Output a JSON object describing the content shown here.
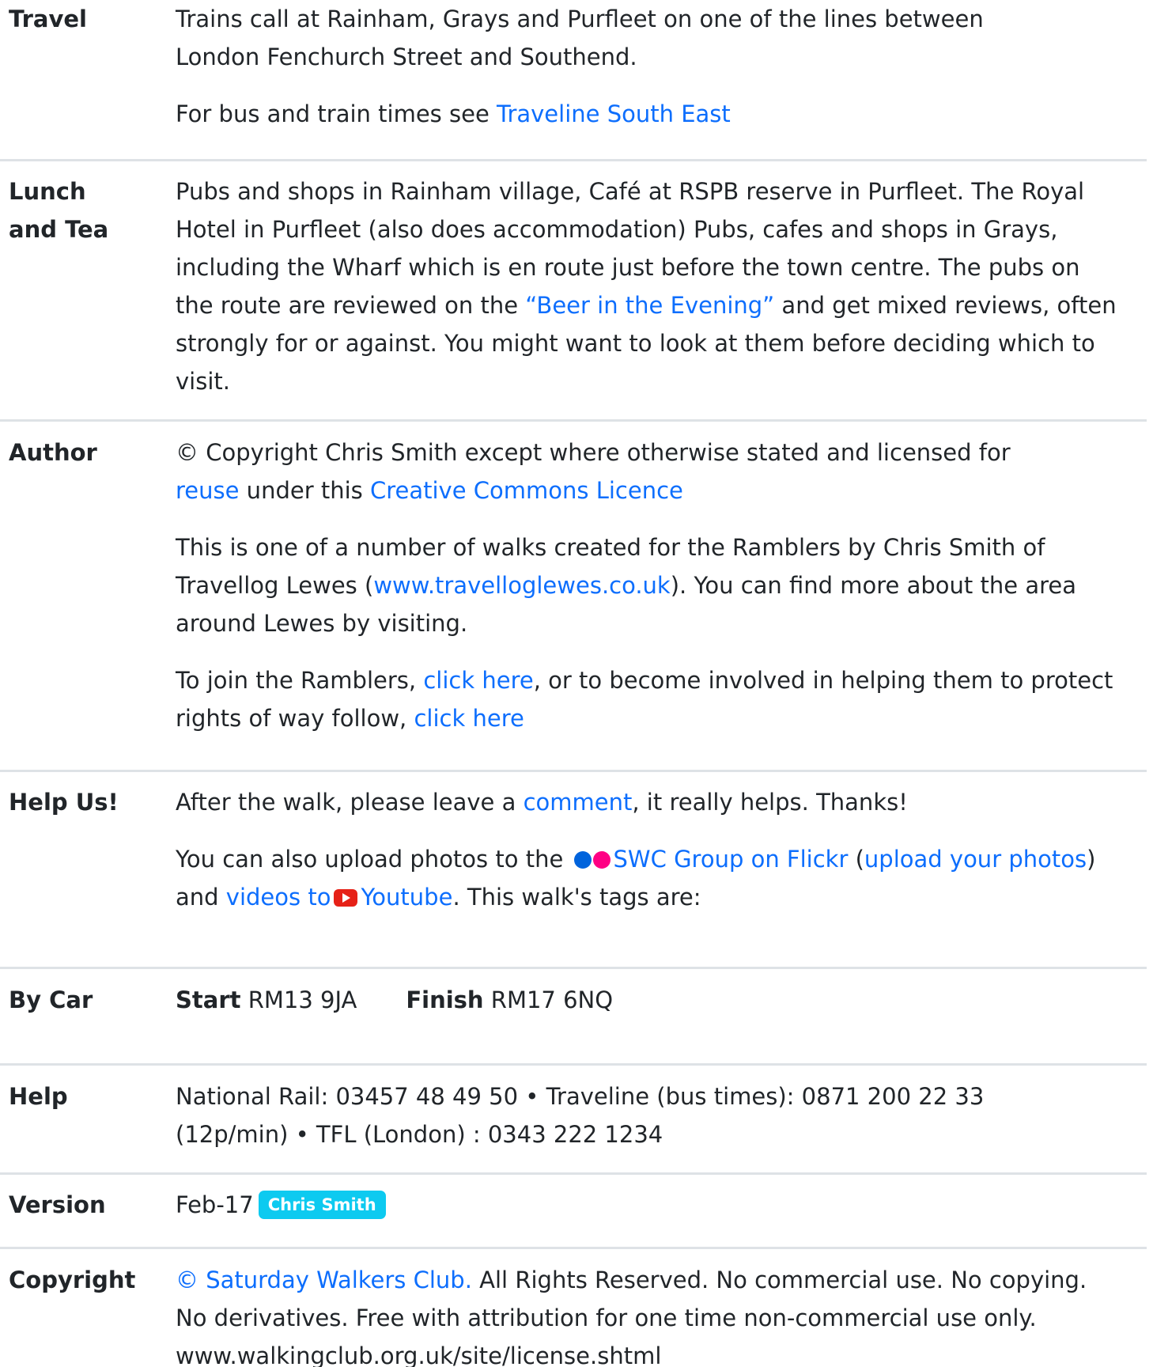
{
  "travel": {
    "label": "Travel",
    "p1": "Trains call at Rainham, Grays and Purfleet on one of the lines between London Fenchurch Street and Southend.",
    "p2_prefix": "For bus and train times see ",
    "p2_link": "Traveline South East"
  },
  "lunch": {
    "label": "Lunch and Tea",
    "text1": "Pubs and shops in Rainham village, Café at RSPB reserve in Purfleet. The Royal Hotel in Purfleet (also does accommodation) Pubs, cafes and shops in Grays, including the Wharf which is en route just before the town centre. The pubs on the route are reviewed on the ",
    "link": "“Beer in the Evening”",
    "text2": " and get mixed reviews, often strongly for or against. You might want to look at them before deciding which to visit."
  },
  "author": {
    "label": "Author",
    "p1_text1": "© Copyright Chris Smith except where otherwise stated and licensed for ",
    "p1_link1": "reuse",
    "p1_text2": " under this ",
    "p1_link2": "Creative Commons Licence",
    "p2_text1": "This is one of a number of walks created for the Ramblers by Chris Smith of Travellog Lewes (",
    "p2_link": "www.travelloglewes.co.uk",
    "p2_text2": "). You can find more about the area around Lewes by visiting.",
    "p3_text1": "To join the Ramblers, ",
    "p3_link1": "click here",
    "p3_text2": ", or to become involved in helping them to protect rights of way follow, ",
    "p3_link2": "click here"
  },
  "help_us": {
    "label": "Help Us!",
    "p1_text1": "After the walk, please leave a ",
    "p1_link": "comment",
    "p1_text2": ", it really helps. Thanks!",
    "p2_text1": "You can also upload photos to the ",
    "p2_flickr_link": "SWC Group on Flickr",
    "p2_text2": " (",
    "p2_upload_link": "upload your photos",
    "p2_text3": ") and ",
    "p2_videos_link": "videos to",
    "p2_youtube_link": "Youtube",
    "p2_text4": ". This walk's tags are:",
    "icons": {
      "flickr": "flickr-icon",
      "youtube": "youtube-icon"
    }
  },
  "by_car": {
    "label": "By Car",
    "start_label": "Start",
    "start_value": "RM13 9JA",
    "finish_label": "Finish",
    "finish_value": "RM17 6NQ"
  },
  "help": {
    "label": "Help",
    "text": "National Rail: 03457 48 49 50 • Traveline (bus times): 0871 200 22 33 (12p/min) • TFL (London) : 0343 222 1234"
  },
  "version": {
    "label": "Version",
    "date": "Feb-17",
    "badge": "Chris Smith"
  },
  "copyright": {
    "label": "Copyright",
    "link": "© Saturday Walkers Club.",
    "text": " All Rights Reserved. No commercial use. No copying. No derivatives. Free with attribution for one time non-commercial use only. www.walkingclub.org.uk/site/license.shtml"
  },
  "colors": {
    "link": "#0d6efd",
    "badge": "#0dcaf0",
    "separator": "#dee2e6",
    "flickr_blue": "#0063dc",
    "flickr_pink": "#ff0084",
    "youtube_red": "#e62117"
  }
}
